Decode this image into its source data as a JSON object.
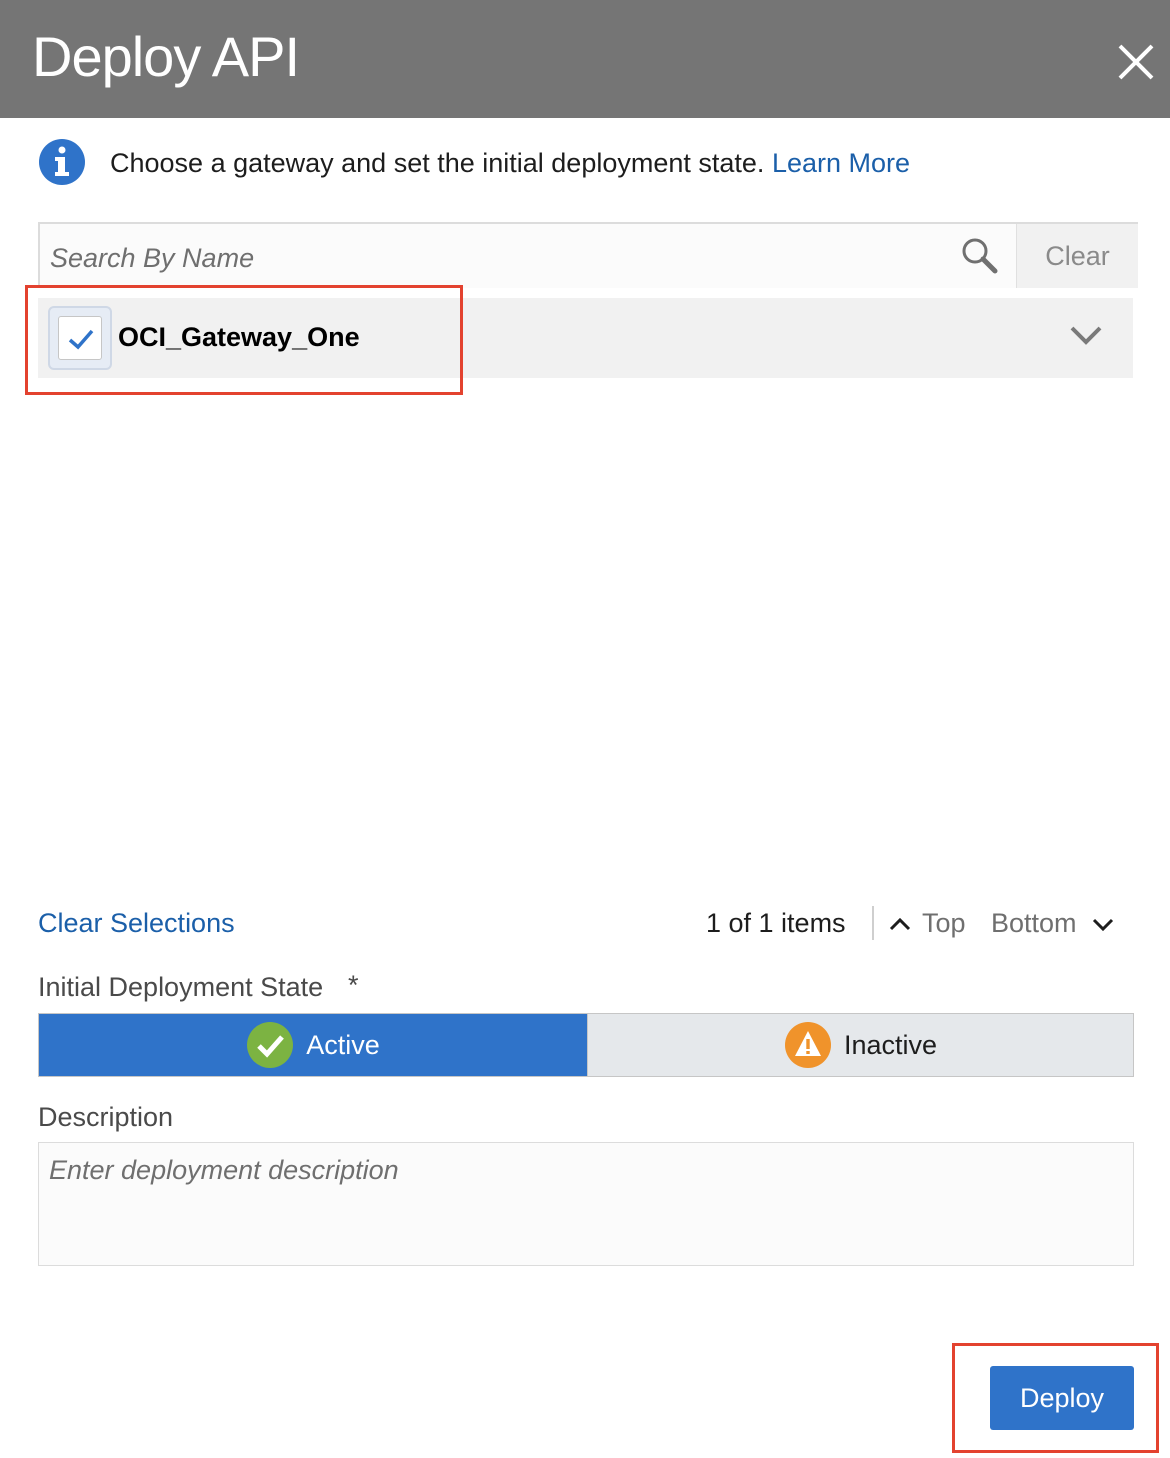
{
  "dialog": {
    "title": "Deploy API",
    "close_icon": "close-icon"
  },
  "info": {
    "icon": "info-icon",
    "message": "Choose a gateway and set the initial deployment state.",
    "learn_more": "Learn More"
  },
  "search": {
    "placeholder": "Search By Name",
    "value": "",
    "icon": "search-icon",
    "clear_label": "Clear"
  },
  "gateways": [
    {
      "name": "OCI_Gateway_One",
      "checked": true
    }
  ],
  "list_footer": {
    "clear_selections": "Clear Selections",
    "item_count": "1 of 1 items",
    "top_label": "Top",
    "bottom_label": "Bottom"
  },
  "deployment_state": {
    "label": "Initial Deployment State",
    "required_marker": "*",
    "options": [
      {
        "label": "Active",
        "selected": true,
        "icon": "check-circle-icon"
      },
      {
        "label": "Inactive",
        "selected": false,
        "icon": "warning-icon"
      }
    ]
  },
  "description": {
    "label": "Description",
    "placeholder": "Enter deployment description",
    "value": ""
  },
  "actions": {
    "deploy_label": "Deploy"
  },
  "colors": {
    "title_bar": "#757575",
    "accent": "#2f73c9",
    "link": "#1b5fa9",
    "highlight": "#e3422f",
    "active_check": "#7cb342",
    "inactive_warning": "#f0932b"
  }
}
